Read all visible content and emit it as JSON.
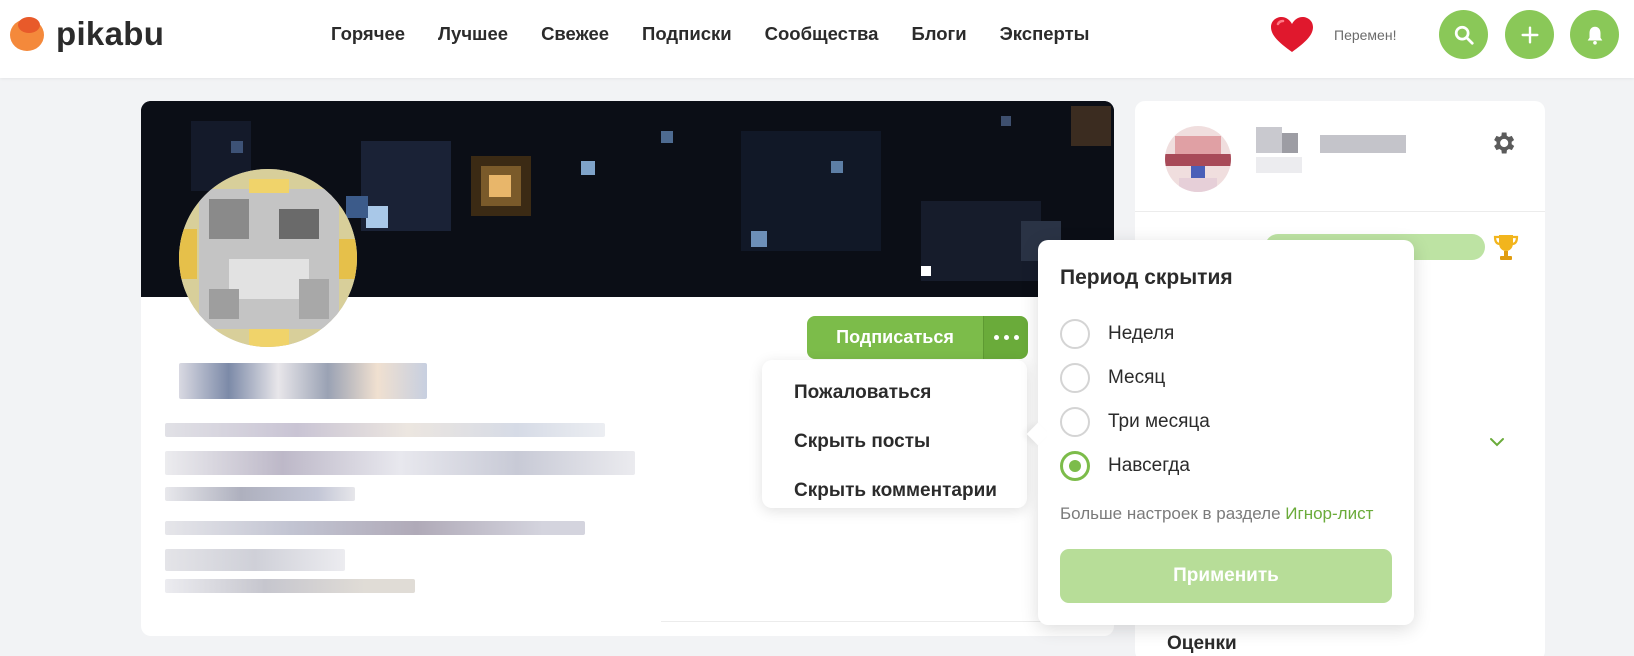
{
  "header": {
    "logo_text": "pikabu",
    "nav": [
      "Горячее",
      "Лучшее",
      "Свежее",
      "Подписки",
      "Сообщества",
      "Блоги",
      "Эксперты"
    ],
    "user_status": "Перемен!"
  },
  "profile": {
    "subscribe_label": "Подписаться"
  },
  "menu": {
    "items": [
      "Пожаловаться",
      "Скрыть посты",
      "Скрыть комментарии"
    ]
  },
  "hide_popup": {
    "title": "Период скрытия",
    "options": [
      {
        "label": "Неделя",
        "checked": false
      },
      {
        "label": "Месяц",
        "checked": false
      },
      {
        "label": "Три месяца",
        "checked": false
      },
      {
        "label": "Навсегда",
        "checked": true
      }
    ],
    "note_prefix": "Больше настроек в разделе",
    "note_link": "Игнор-лист",
    "apply_label": "Применить"
  },
  "sidebar": {
    "ratings_label": "Оценки"
  },
  "colors": {
    "brand_green": "#7cbc4a",
    "brand_orange": "#f4893b",
    "heart_red": "#e0182d"
  }
}
